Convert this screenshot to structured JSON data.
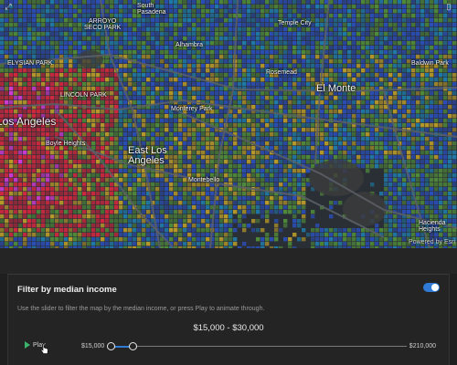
{
  "map": {
    "labels": [
      {
        "name": "South Pasadena",
        "text": "South\nPasadena",
        "size": "sm"
      },
      {
        "name": "Arroyo Seco Park",
        "text": "ARROYO\nSECO PARK",
        "size": "sm"
      },
      {
        "name": "Temple City",
        "text": "Temple City",
        "size": "sm"
      },
      {
        "name": "Elysian Park",
        "text": "ELYSIAN PARK",
        "size": "sm"
      },
      {
        "name": "Alhambra",
        "text": "Alhambra",
        "size": "sm"
      },
      {
        "name": "Baldwin Park",
        "text": "Baldwin Park",
        "size": "sm"
      },
      {
        "name": "Rosemead",
        "text": "Rosemead",
        "size": "sm"
      },
      {
        "name": "Lincoln Park",
        "text": "LINCOLN PARK",
        "size": "sm"
      },
      {
        "name": "El Monte",
        "text": "El Monte",
        "size": "lg"
      },
      {
        "name": "Los Angeles",
        "text": "Los Angeles",
        "size": "xl"
      },
      {
        "name": "Monterey Park",
        "text": "Monterey Park",
        "size": "sm"
      },
      {
        "name": "Boyle Heights",
        "text": "Boyle Heights",
        "size": "sm"
      },
      {
        "name": "East Los Angeles",
        "text": "East Los\nAngeles",
        "size": "lg"
      },
      {
        "name": "Montebello",
        "text": "Montebello",
        "size": "sm"
      },
      {
        "name": "Hacienda Heights",
        "text": "Hacienda\nHeights",
        "size": "sm"
      }
    ],
    "attribution": "Powered by Esri",
    "colors": {
      "high_income": "#2a4fb8",
      "upper_middle": "#1f7aa8",
      "middle": "#4f8a3a",
      "lower_middle": "#b89a2a",
      "low_income": "#d0283f",
      "highlight": "#d23bd8",
      "water": "#2a2e35"
    }
  },
  "panel": {
    "title": "Filter by median income",
    "toggle_on": true,
    "description": "Use the slider to filter the map by the median income, or press Play to animate through.",
    "range_text": "$15,000 - $30,000",
    "play_label": "Play",
    "min_label": "$15,000",
    "max_label": "$210,000",
    "slider": {
      "min": 15000,
      "max": 210000,
      "low": 15000,
      "high": 30000
    },
    "accent": "#2f7bd6",
    "play_color": "#3bb36a"
  }
}
